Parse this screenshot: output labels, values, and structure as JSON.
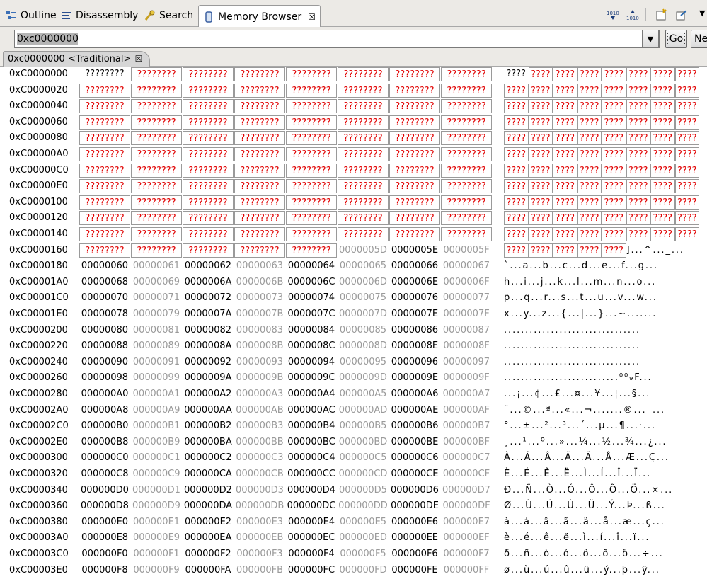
{
  "tabs": [
    {
      "name": "tab-outline",
      "label": "Outline",
      "icon": "outline-icon",
      "active": false
    },
    {
      "name": "tab-disassembly",
      "label": "Disassembly",
      "icon": "disassembly-icon",
      "active": false
    },
    {
      "name": "tab-search",
      "label": "Search",
      "icon": "search-icon",
      "active": false
    },
    {
      "name": "tab-memory-browser",
      "label": "Memory Browser",
      "icon": "memory-icon",
      "active": true,
      "close": "☒"
    }
  ],
  "toolbar": {
    "binary1": "1010",
    "binary2": "1010"
  },
  "address_bar": {
    "value": "0xc0000000",
    "go_label": "Go",
    "new_tab_label": "Ne"
  },
  "rendering_tab": {
    "label": "0xc0000000 <Traditional>",
    "close": "☒"
  },
  "unknown_glyph": "????????",
  "unknown_ascii": "????",
  "colors": {
    "unknown_text": "#e00000",
    "odd_word_text": "#9a9a9a"
  },
  "memory": {
    "rows": [
      {
        "address": "0xC0000000",
        "words": [
          "????????",
          "????????",
          "????????",
          "????????",
          "????????",
          "????????",
          "????????",
          "????????"
        ],
        "ascii": "????????????????????????????????"
      },
      {
        "address": "0xC0000020",
        "words": [
          "????????",
          "????????",
          "????????",
          "????????",
          "????????",
          "????????",
          "????????",
          "????????"
        ],
        "ascii": "????????????????????????????????"
      },
      {
        "address": "0xC0000040",
        "words": [
          "????????",
          "????????",
          "????????",
          "????????",
          "????????",
          "????????",
          "????????",
          "????????"
        ],
        "ascii": "????????????????????????????????"
      },
      {
        "address": "0xC0000060",
        "words": [
          "????????",
          "????????",
          "????????",
          "????????",
          "????????",
          "????????",
          "????????",
          "????????"
        ],
        "ascii": "????????????????????????????????"
      },
      {
        "address": "0xC0000080",
        "words": [
          "????????",
          "????????",
          "????????",
          "????????",
          "????????",
          "????????",
          "????????",
          "????????"
        ],
        "ascii": "????????????????????????????????"
      },
      {
        "address": "0xC00000A0",
        "words": [
          "????????",
          "????????",
          "????????",
          "????????",
          "????????",
          "????????",
          "????????",
          "????????"
        ],
        "ascii": "????????????????????????????????"
      },
      {
        "address": "0xC00000C0",
        "words": [
          "????????",
          "????????",
          "????????",
          "????????",
          "????????",
          "????????",
          "????????",
          "????????"
        ],
        "ascii": "????????????????????????????????"
      },
      {
        "address": "0xC00000E0",
        "words": [
          "????????",
          "????????",
          "????????",
          "????????",
          "????????",
          "????????",
          "????????",
          "????????"
        ],
        "ascii": "????????????????????????????????"
      },
      {
        "address": "0xC0000100",
        "words": [
          "????????",
          "????????",
          "????????",
          "????????",
          "????????",
          "????????",
          "????????",
          "????????"
        ],
        "ascii": "????????????????????????????????"
      },
      {
        "address": "0xC0000120",
        "words": [
          "????????",
          "????????",
          "????????",
          "????????",
          "????????",
          "????????",
          "????????",
          "????????"
        ],
        "ascii": "????????????????????????????????"
      },
      {
        "address": "0xC0000140",
        "words": [
          "????????",
          "????????",
          "????????",
          "????????",
          "????????",
          "????????",
          "????????",
          "????????"
        ],
        "ascii": "????????????????????????????????"
      },
      {
        "address": "0xC0000160",
        "words": [
          "????????",
          "????????",
          "????????",
          "????????",
          "????????",
          "0000005D",
          "0000005E",
          "0000005F"
        ],
        "ascii": "????????????????????]...^..._..."
      },
      {
        "address": "0xC0000180",
        "words": [
          "00000060",
          "00000061",
          "00000062",
          "00000063",
          "00000064",
          "00000065",
          "00000066",
          "00000067"
        ],
        "ascii": "`...a...b...c...d...e...f...g..."
      },
      {
        "address": "0xC00001A0",
        "words": [
          "00000068",
          "00000069",
          "0000006A",
          "0000006B",
          "0000006C",
          "0000006D",
          "0000006E",
          "0000006F"
        ],
        "ascii": "h...i...j...k...l...m...n...o..."
      },
      {
        "address": "0xC00001C0",
        "words": [
          "00000070",
          "00000071",
          "00000072",
          "00000073",
          "00000074",
          "00000075",
          "00000076",
          "00000077"
        ],
        "ascii": "p...q...r...s...t...u...v...w..."
      },
      {
        "address": "0xC00001E0",
        "words": [
          "00000078",
          "00000079",
          "0000007A",
          "0000007B",
          "0000007C",
          "0000007D",
          "0000007E",
          "0000007F"
        ],
        "ascii": "x...y...z...{...|...}...~......."
      },
      {
        "address": "0xC0000200",
        "words": [
          "00000080",
          "00000081",
          "00000082",
          "00000083",
          "00000084",
          "00000085",
          "00000086",
          "00000087"
        ],
        "ascii": "................................"
      },
      {
        "address": "0xC0000220",
        "words": [
          "00000088",
          "00000089",
          "0000008A",
          "0000008B",
          "0000008C",
          "0000008D",
          "0000008E",
          "0000008F"
        ],
        "ascii": "................................"
      },
      {
        "address": "0xC0000240",
        "words": [
          "00000090",
          "00000091",
          "00000092",
          "00000093",
          "00000094",
          "00000095",
          "00000096",
          "00000097"
        ],
        "ascii": "................................"
      },
      {
        "address": "0xC0000260",
        "words": [
          "00000098",
          "00000099",
          "0000009A",
          "0000009B",
          "0000009C",
          "0000009D",
          "0000009E",
          "0000009F"
        ],
        "ascii": "...........................⁰⁰₉F..."
      },
      {
        "address": "0xC0000280",
        "words": [
          "000000A0",
          "000000A1",
          "000000A2",
          "000000A3",
          "000000A4",
          "000000A5",
          "000000A6",
          "000000A7"
        ],
        "ascii": " ...¡...¢...£...¤...¥...¦...§..."
      },
      {
        "address": "0xC00002A0",
        "words": [
          "000000A8",
          "000000A9",
          "000000AA",
          "000000AB",
          "000000AC",
          "000000AD",
          "000000AE",
          "000000AF"
        ],
        "ascii": "¨...©...ª...«...¬.......®...¯..."
      },
      {
        "address": "0xC00002C0",
        "words": [
          "000000B0",
          "000000B1",
          "000000B2",
          "000000B3",
          "000000B4",
          "000000B5",
          "000000B6",
          "000000B7"
        ],
        "ascii": "°...±...²...³...´...µ...¶...·..."
      },
      {
        "address": "0xC00002E0",
        "words": [
          "000000B8",
          "000000B9",
          "000000BA",
          "000000BB",
          "000000BC",
          "000000BD",
          "000000BE",
          "000000BF"
        ],
        "ascii": "¸...¹...º...»...¼...½...¾...¿..."
      },
      {
        "address": "0xC0000300",
        "words": [
          "000000C0",
          "000000C1",
          "000000C2",
          "000000C3",
          "000000C4",
          "000000C5",
          "000000C6",
          "000000C7"
        ],
        "ascii": "À...Á...Â...Ã...Ä...Å...Æ...Ç..."
      },
      {
        "address": "0xC0000320",
        "words": [
          "000000C8",
          "000000C9",
          "000000CA",
          "000000CB",
          "000000CC",
          "000000CD",
          "000000CE",
          "000000CF"
        ],
        "ascii": "È...É...Ê...Ë...Ì...Í...Î...Ï..."
      },
      {
        "address": "0xC0000340",
        "words": [
          "000000D0",
          "000000D1",
          "000000D2",
          "000000D3",
          "000000D4",
          "000000D5",
          "000000D6",
          "000000D7"
        ],
        "ascii": "Ð...Ñ...Ò...Ó...Ô...Õ...Ö...×..."
      },
      {
        "address": "0xC0000360",
        "words": [
          "000000D8",
          "000000D9",
          "000000DA",
          "000000DB",
          "000000DC",
          "000000DD",
          "000000DE",
          "000000DF"
        ],
        "ascii": "Ø...Ù...Ú...Û...Ü...Ý...Þ...ß..."
      },
      {
        "address": "0xC0000380",
        "words": [
          "000000E0",
          "000000E1",
          "000000E2",
          "000000E3",
          "000000E4",
          "000000E5",
          "000000E6",
          "000000E7"
        ],
        "ascii": "à...á...â...ã...ä...å...æ...ç..."
      },
      {
        "address": "0xC00003A0",
        "words": [
          "000000E8",
          "000000E9",
          "000000EA",
          "000000EB",
          "000000EC",
          "000000ED",
          "000000EE",
          "000000EF"
        ],
        "ascii": "è...é...ê...ë...ì...í...î...ï..."
      },
      {
        "address": "0xC00003C0",
        "words": [
          "000000F0",
          "000000F1",
          "000000F2",
          "000000F3",
          "000000F4",
          "000000F5",
          "000000F6",
          "000000F7"
        ],
        "ascii": "ð...ñ...ò...ó...ô...õ...ö...÷..."
      },
      {
        "address": "0xC00003E0",
        "words": [
          "000000F8",
          "000000F9",
          "000000FA",
          "000000FB",
          "000000FC",
          "000000FD",
          "000000FE",
          "000000FF"
        ],
        "ascii": "ø...ù...ú...û...ü...ý...þ...ÿ..."
      }
    ]
  }
}
